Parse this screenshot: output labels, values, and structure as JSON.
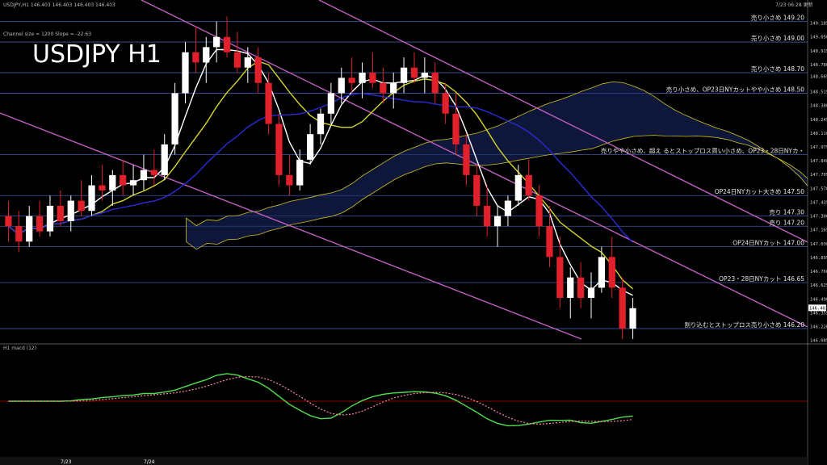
{
  "header": {
    "symbol_info": "USDJPY,H1  146.403 146.403 146.403 146.403",
    "timestamp": "7/23  06:28  更新",
    "channel_info": "Channel size = 1200 Slope = -22.63",
    "watermark": "USDJPY  H1"
  },
  "macd_label": "H1  macd (12)",
  "dates": [
    "7/23",
    "7/24"
  ],
  "colors": {
    "bull": "#ffffff",
    "bear": "#e0202a",
    "ma_short": "#ffffff",
    "ma_mid": "#d6d62a",
    "ma_long": "#2b2bd8",
    "channel": "#c060c0",
    "level": "#3c5aa8",
    "ichimoku": "#d2c21e",
    "chikou": "#2fae2f",
    "macd": "#4fe04f",
    "signal": "#ff8aa0"
  },
  "chart_data": {
    "type": "line",
    "title": "USDJPY H1",
    "ylim": [
      146.035,
      149.3
    ],
    "y_ticks": [
      "149.185",
      "149.050",
      "148.915",
      "148.780",
      "148.665",
      "148.515",
      "148.380",
      "148.245",
      "148.110",
      "147.975",
      "147.840",
      "147.705",
      "147.570",
      "147.435",
      "147.300",
      "147.165",
      "147.030",
      "146.895",
      "146.760",
      "146.625",
      "146.490",
      "146.355",
      "146.220",
      "146.085"
    ],
    "last_price": "146.403",
    "levels": [
      {
        "price": 149.2,
        "label": "売り小さめ 149.20"
      },
      {
        "price": 149.0,
        "label": "売り小さめ 149.00"
      },
      {
        "price": 148.7,
        "label": "売り小さめ 148.70"
      },
      {
        "price": 148.5,
        "label": "売り小さめ、OP23日NYカットやや小さめ 148.50"
      },
      {
        "price": 147.9,
        "label": "売りやや小さめ、超え るとストップロス買い小さめ、OP23・28日NYカ・"
      },
      {
        "price": 147.5,
        "label": "OP24日NYカット大きめ 147.50"
      },
      {
        "price": 147.3,
        "label": "売り 147.30"
      },
      {
        "price": 147.2,
        "label": "売り 147.20"
      },
      {
        "price": 147.0,
        "label": "OP24日NYカット 147.00"
      },
      {
        "price": 146.65,
        "label": "OP23・28日NYカット 146.65"
      },
      {
        "price": 146.2,
        "label": "割り込むとストップロス売り小さめ 146.20"
      }
    ],
    "candles": [
      [
        147.3,
        147.45,
        147.05,
        147.2
      ],
      [
        147.2,
        147.35,
        146.95,
        147.05
      ],
      [
        147.05,
        147.4,
        147.0,
        147.3
      ],
      [
        147.3,
        147.45,
        147.1,
        147.15
      ],
      [
        147.15,
        147.5,
        147.1,
        147.4
      ],
      [
        147.4,
        147.55,
        147.2,
        147.25
      ],
      [
        147.25,
        147.5,
        147.15,
        147.45
      ],
      [
        147.45,
        147.65,
        147.3,
        147.35
      ],
      [
        147.35,
        147.7,
        147.3,
        147.6
      ],
      [
        147.6,
        147.8,
        147.45,
        147.55
      ],
      [
        147.55,
        147.75,
        147.4,
        147.7
      ],
      [
        147.7,
        147.85,
        147.5,
        147.6
      ],
      [
        147.6,
        147.8,
        147.5,
        147.65
      ],
      [
        147.65,
        147.9,
        147.55,
        147.75
      ],
      [
        147.75,
        147.95,
        147.6,
        147.7
      ],
      [
        147.7,
        148.1,
        147.65,
        148.0
      ],
      [
        148.0,
        148.6,
        147.9,
        148.5
      ],
      [
        148.5,
        149.0,
        148.4,
        148.9
      ],
      [
        148.9,
        149.15,
        148.7,
        148.8
      ],
      [
        148.8,
        149.05,
        148.6,
        148.95
      ],
      [
        148.95,
        149.2,
        148.8,
        149.05
      ],
      [
        149.05,
        149.25,
        148.85,
        148.9
      ],
      [
        148.9,
        149.1,
        148.7,
        148.75
      ],
      [
        148.75,
        148.95,
        148.6,
        148.85
      ],
      [
        148.85,
        148.95,
        148.5,
        148.6
      ],
      [
        148.6,
        148.7,
        148.1,
        148.2
      ],
      [
        148.2,
        148.3,
        147.6,
        147.7
      ],
      [
        147.7,
        147.9,
        147.5,
        147.6
      ],
      [
        147.6,
        147.95,
        147.55,
        147.85
      ],
      [
        147.85,
        148.2,
        147.8,
        148.1
      ],
      [
        148.1,
        148.35,
        148.0,
        148.3
      ],
      [
        148.3,
        148.6,
        148.2,
        148.5
      ],
      [
        148.5,
        148.75,
        148.4,
        148.65
      ],
      [
        148.65,
        148.85,
        148.5,
        148.6
      ],
      [
        148.6,
        148.8,
        148.45,
        148.7
      ],
      [
        148.7,
        148.9,
        148.55,
        148.6
      ],
      [
        148.6,
        148.75,
        148.4,
        148.5
      ],
      [
        148.5,
        148.7,
        148.35,
        148.6
      ],
      [
        148.6,
        148.85,
        148.5,
        148.75
      ],
      [
        148.75,
        148.9,
        148.6,
        148.65
      ],
      [
        148.65,
        148.85,
        148.5,
        148.7
      ],
      [
        148.7,
        148.8,
        148.4,
        148.5
      ],
      [
        148.5,
        148.6,
        148.2,
        148.3
      ],
      [
        148.3,
        148.5,
        147.9,
        148.0
      ],
      [
        148.0,
        148.1,
        147.6,
        147.7
      ],
      [
        147.7,
        147.8,
        147.3,
        147.4
      ],
      [
        147.4,
        147.6,
        147.1,
        147.2
      ],
      [
        147.2,
        147.4,
        147.0,
        147.3
      ],
      [
        147.3,
        147.5,
        147.2,
        147.45
      ],
      [
        147.45,
        147.8,
        147.4,
        147.7
      ],
      [
        147.7,
        147.85,
        147.45,
        147.5
      ],
      [
        147.5,
        147.6,
        147.1,
        147.2
      ],
      [
        147.2,
        147.4,
        146.8,
        146.9
      ],
      [
        146.9,
        147.1,
        146.4,
        146.5
      ],
      [
        146.5,
        146.8,
        146.3,
        146.7
      ],
      [
        146.7,
        146.85,
        146.4,
        146.5
      ],
      [
        146.5,
        146.75,
        146.3,
        146.6
      ],
      [
        146.6,
        147.0,
        146.55,
        146.9
      ],
      [
        146.9,
        147.1,
        146.5,
        146.6
      ],
      [
        146.6,
        146.7,
        146.1,
        146.2
      ],
      [
        146.2,
        146.5,
        146.1,
        146.4
      ]
    ]
  }
}
